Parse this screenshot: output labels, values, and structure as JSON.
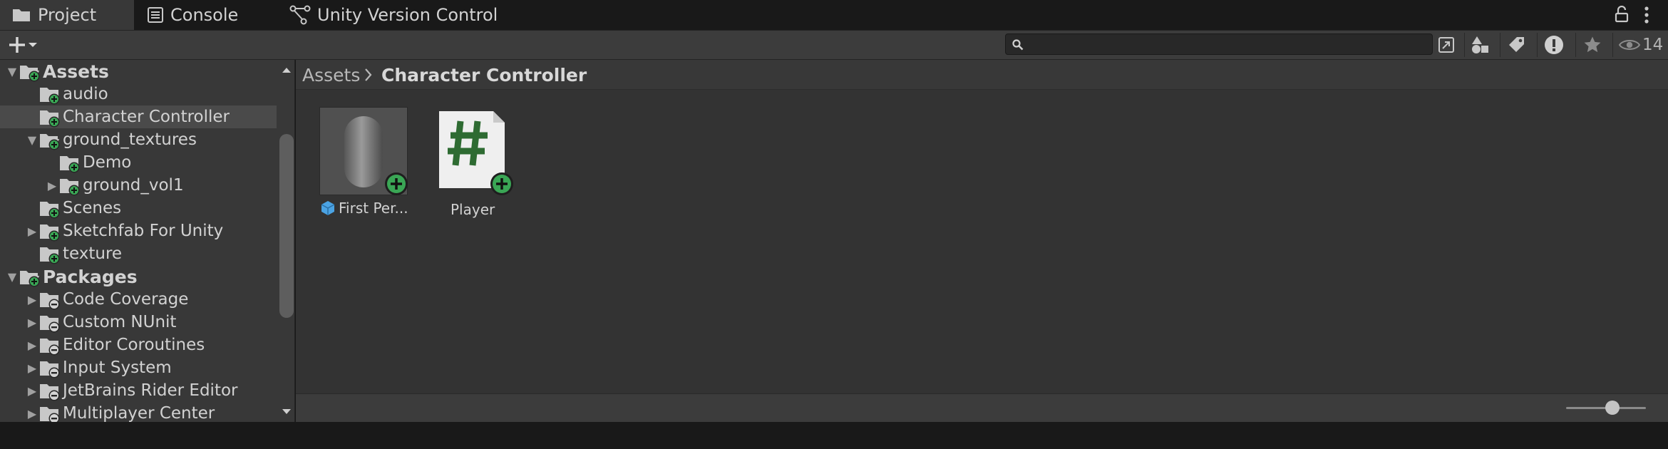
{
  "tabs": [
    {
      "label": "Project",
      "icon": "folder-icon",
      "active": true
    },
    {
      "label": "Console",
      "icon": "console-icon",
      "active": false
    },
    {
      "label": "Unity Version Control",
      "icon": "version-control-icon",
      "active": false
    }
  ],
  "toolbar": {
    "create_icon": "plus-icon",
    "search_placeholder": "",
    "hidden_count": "14"
  },
  "tree": {
    "items": [
      {
        "label": "Assets",
        "depth": 0,
        "expand": "open",
        "top_level": true
      },
      {
        "label": "audio",
        "depth": 1,
        "expand": "none"
      },
      {
        "label": "Character Controller",
        "depth": 1,
        "expand": "none",
        "selected": true
      },
      {
        "label": "ground_textures",
        "depth": 1,
        "expand": "open"
      },
      {
        "label": "Demo",
        "depth": 2,
        "expand": "none"
      },
      {
        "label": "ground_vol1",
        "depth": 2,
        "expand": "closed"
      },
      {
        "label": "Scenes",
        "depth": 1,
        "expand": "none"
      },
      {
        "label": "Sketchfab For Unity",
        "depth": 1,
        "expand": "closed"
      },
      {
        "label": "texture",
        "depth": 1,
        "expand": "none"
      },
      {
        "label": "Packages",
        "depth": 0,
        "expand": "open",
        "top_level": true
      },
      {
        "label": "Code Coverage",
        "depth": 1,
        "expand": "closed",
        "package": true
      },
      {
        "label": "Custom NUnit",
        "depth": 1,
        "expand": "closed",
        "package": true
      },
      {
        "label": "Editor Coroutines",
        "depth": 1,
        "expand": "closed",
        "package": true
      },
      {
        "label": "Input System",
        "depth": 1,
        "expand": "closed",
        "package": true
      },
      {
        "label": "JetBrains Rider Editor",
        "depth": 1,
        "expand": "closed",
        "package": true
      },
      {
        "label": "Multiplayer Center",
        "depth": 1,
        "expand": "closed",
        "package": true
      }
    ]
  },
  "breadcrumb": {
    "root": "Assets",
    "current": "Character Controller"
  },
  "assets": [
    {
      "label": "First Per...",
      "type": "prefab"
    },
    {
      "label": "Player",
      "type": "script"
    }
  ],
  "colors": {
    "accent_add": "#3aa655",
    "script_hash": "#2e6b32",
    "prefab_blue": "#4ba3e3"
  }
}
